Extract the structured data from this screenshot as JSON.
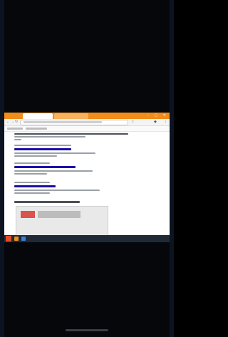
{
  "browser": {
    "active_tab_label": "",
    "inactive_tab_label": "",
    "window_controls": "– ▢ ✕"
  },
  "nav": {
    "back_icon": "back-arrow-icon",
    "forward_icon": "forward-arrow-icon",
    "reload_icon": "reload-icon",
    "menu_icon": "menu-icon"
  },
  "taskbar": {
    "tray_text": ""
  },
  "colors": {
    "tab_strip": "#f28c1a",
    "link": "#1a0dab",
    "url_green": "#1e7c3a",
    "taskbar": "#1f2a36",
    "start": "#e24b2a"
  }
}
